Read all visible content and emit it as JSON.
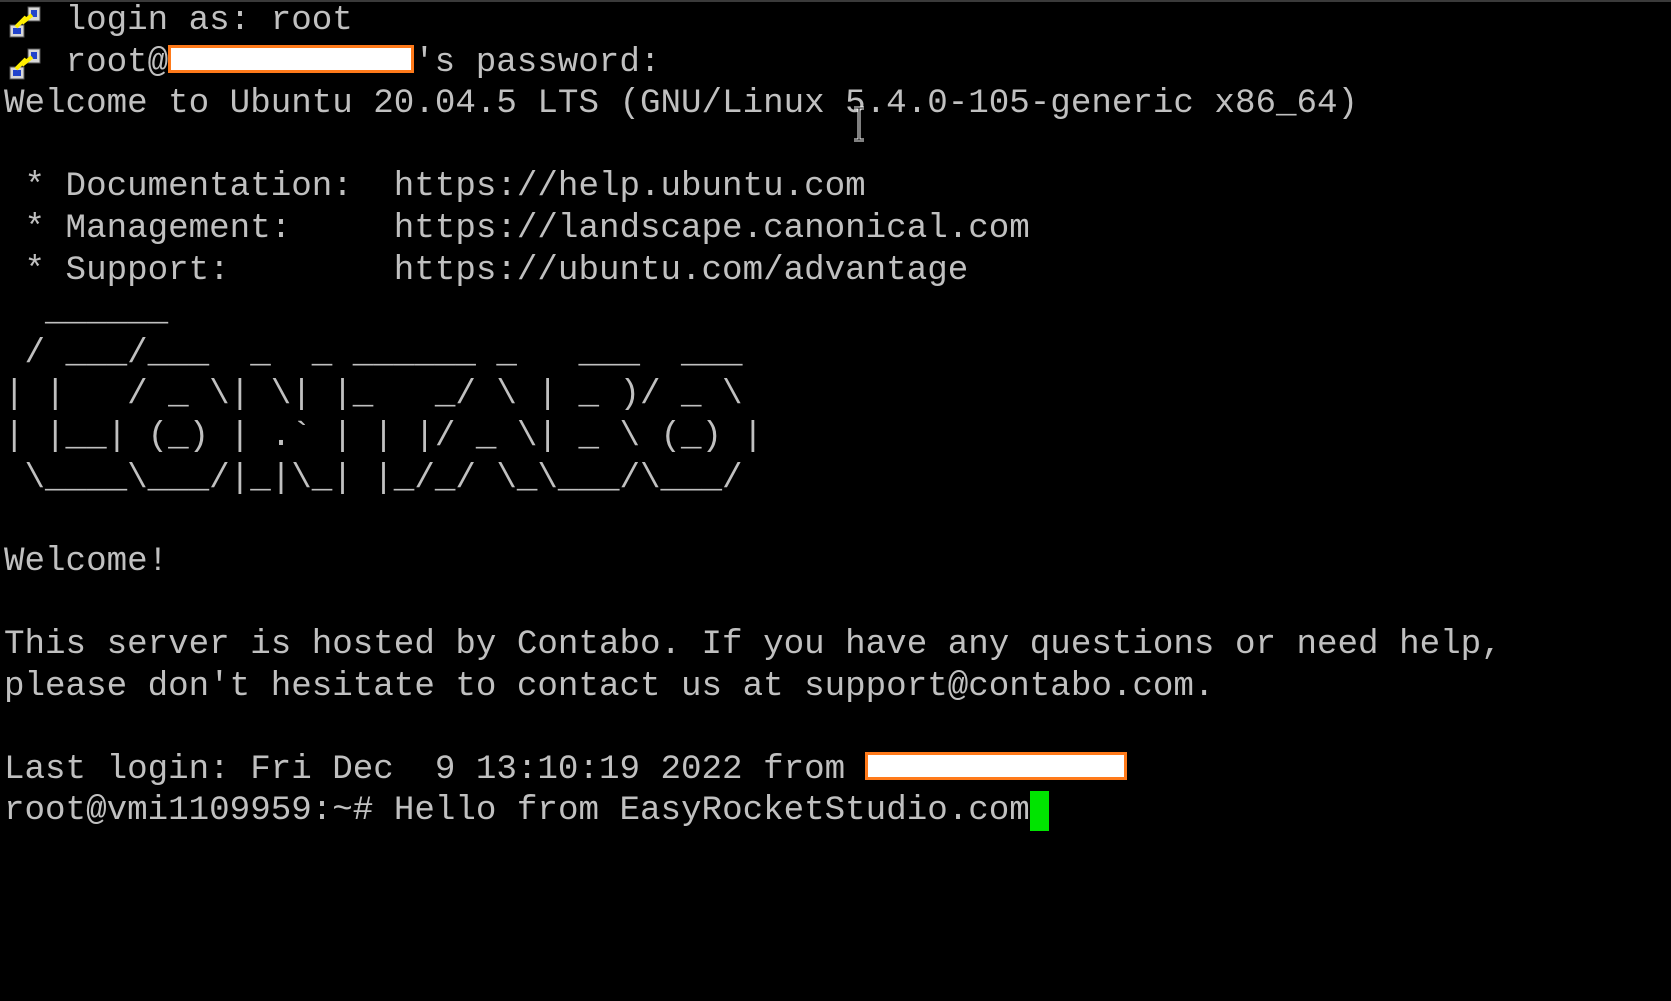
{
  "terminal": {
    "login_line": "login as: root",
    "password_prefix": "root@",
    "password_suffix": "'s password:",
    "welcome": "Welcome to Ubuntu 20.04.5 LTS (GNU/Linux 5.4.0-105-generic x86_64)",
    "motd_links": [
      " * Documentation:  https://help.ubuntu.com",
      " * Management:     https://landscape.canonical.com",
      " * Support:        https://ubuntu.com/advantage"
    ],
    "banner": [
      "  ______",
      " / ___/___  _  _ ______ _   ___  ___",
      "| |   / _ \\| \\| |_   _/ \\ | _ )/ _ \\",
      "| |__| (_) | .` | | |/ _ \\| _ \\ (_) |",
      " \\____\\___/|_|\\_| |_/_/ \\_\\___/\\___/"
    ],
    "greeting": "Welcome!",
    "hosted_1": "This server is hosted by Contabo. If you have any questions or need help,",
    "hosted_2": "please don't hesitate to contact us at support@contabo.com.",
    "last_login": "Last login: Fri Dec  9 13:10:19 2022 from",
    "prompt": "root@vmi1109959:~#",
    "command": " Hello from EasyRocketStudio.com"
  },
  "colors": {
    "text": "#c0c0c0",
    "cursor": "#00e400",
    "redaction_border": "#ff7a1a",
    "background": "#000000"
  },
  "icons": {
    "session": "putty-icon",
    "mouse": "text-cursor-ibeam-icon"
  }
}
